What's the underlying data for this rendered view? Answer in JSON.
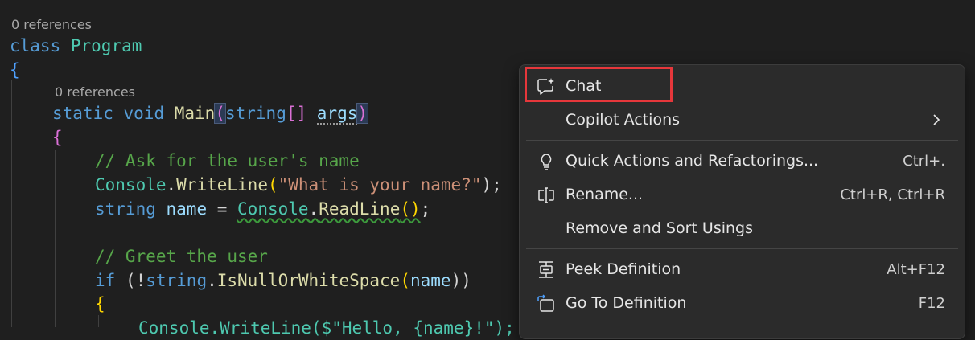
{
  "code": {
    "lens_class": "0 references",
    "lens_main": "0 references",
    "class_kw": "class",
    "class_name": "Program",
    "open_brace": "{",
    "static_kw": "static",
    "void_kw": "void",
    "main_name": "Main",
    "paren_open": "(",
    "string_kw": "string",
    "array_brackets": "[]",
    "args": "args",
    "paren_close": ")",
    "method_brace": "{",
    "comment1": "// Ask for the user's name",
    "console": "Console",
    "dot": ".",
    "writeline": "WriteLine",
    "writeline_str": "\"What is your name?\"",
    "semi_close": ");",
    "string_type": "string",
    "name_var": "name",
    "equals": " = ",
    "readline": "ReadLine",
    "parens": "()",
    "semi": ";",
    "comment2": "// Greet the user",
    "if_kw": "if",
    "if_open": " (!",
    "isnull": "IsNullOrWhiteSpace",
    "if_close": "))",
    "if_brace": "{",
    "partial_line": "Console.WriteLine($\"Hello, {name}!\");"
  },
  "menu": {
    "chat": "Chat",
    "copilot_actions": "Copilot Actions",
    "quick_actions": "Quick Actions and Refactorings...",
    "quick_actions_shortcut": "Ctrl+.",
    "rename": "Rename...",
    "rename_shortcut": "Ctrl+R, Ctrl+R",
    "remove_sort": "Remove and Sort Usings",
    "peek_definition": "Peek Definition",
    "peek_shortcut": "Alt+F12",
    "goto_definition": "Go To Definition",
    "goto_shortcut": "F12"
  },
  "icons": {
    "chat": "chat-sparkle-icon",
    "submenu": "chevron-right-icon",
    "quick_actions": "lightbulb-icon",
    "rename": "rename-icon",
    "peek": "peek-definition-icon",
    "goto": "go-to-definition-icon"
  },
  "colors": {
    "editor_bg": "#1f1f1f",
    "menu_bg": "#2b2b2b",
    "highlight_border": "#e6373b"
  }
}
